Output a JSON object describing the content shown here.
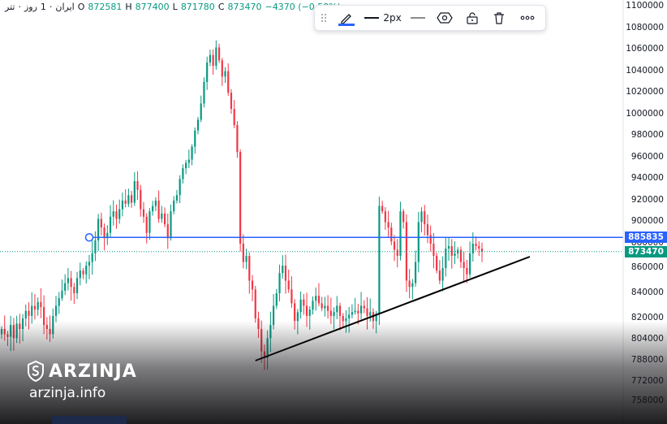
{
  "legend": {
    "symbol": "تتر",
    "separator1": "·",
    "interval": "روز",
    "interval_num": "1",
    "separator2": "·",
    "exchange": "ایران",
    "o_label": "O",
    "o_value": "872581",
    "h_label": "H",
    "h_value": "877400",
    "l_label": "L",
    "l_value": "871780",
    "c_label": "C",
    "c_value": "873470",
    "change": "−4370 (−0.50%)"
  },
  "toolbar": {
    "line_width_label": "2px",
    "icons": [
      "drag-handle-icon",
      "pencil-icon",
      "line-width-icon",
      "line-style-icon",
      "settings-icon",
      "lock-icon",
      "trash-icon",
      "more-icon"
    ]
  },
  "colors": {
    "up": "#089981",
    "down": "#f23645",
    "hline": "#2962ff",
    "trend": "#000000",
    "badge_line": "#2962ff",
    "badge_last": "#089981"
  },
  "chart_data": {
    "type": "candlestick",
    "ylim": [
      750000,
      1100000
    ],
    "yticks": [
      1100000,
      1080000,
      1060000,
      1040000,
      1020000,
      1000000,
      980000,
      960000,
      940000,
      920000,
      900000,
      880000,
      860000,
      840000,
      820000,
      804000,
      788000,
      772000,
      758000
    ],
    "ytick_labels": [
      "1100000",
      "1080000",
      "1060000",
      "1040000",
      "1020000",
      "1000000",
      "980000",
      "960000",
      "940000",
      "920000",
      "900000",
      "880000",
      "860000",
      "840000",
      "820000",
      "804000",
      "788000",
      "772000",
      "758000"
    ],
    "horizontal_line": {
      "value": 885835,
      "label": "885835"
    },
    "last_price": {
      "value": 873470,
      "label": "873470"
    },
    "trendline": {
      "start_index": 84,
      "start_value": 788000,
      "end_index": 162,
      "end_value": 869000
    },
    "closes": [
      812000,
      808000,
      806000,
      815000,
      805000,
      816000,
      812000,
      820000,
      826000,
      822000,
      830000,
      827000,
      833000,
      829000,
      815000,
      812000,
      808000,
      822000,
      830000,
      836000,
      842000,
      848000,
      852000,
      845000,
      840000,
      852000,
      858000,
      855000,
      862000,
      865000,
      872000,
      883000,
      903000,
      895000,
      885000,
      890000,
      905000,
      910000,
      903000,
      912000,
      920000,
      917000,
      925000,
      918000,
      938000,
      930000,
      912000,
      905000,
      890000,
      910000,
      915000,
      920000,
      903000,
      908000,
      898000,
      885000,
      910000,
      920000,
      925000,
      940000,
      950000,
      955000,
      958000,
      970000,
      985000,
      995000,
      1010000,
      1030000,
      1048000,
      1055000,
      1045000,
      1062000,
      1050000,
      1035000,
      1040000,
      1020000,
      1005000,
      990000,
      965000,
      880000,
      865000,
      870000,
      850000,
      843000,
      820000,
      812000,
      795000,
      790000,
      805000,
      815000,
      830000,
      840000,
      856000,
      862000,
      850000,
      843000,
      832000,
      818000,
      825000,
      835000,
      830000,
      822000,
      827000,
      834000,
      838000,
      832000,
      828000,
      830000,
      826000,
      822000,
      825000,
      830000,
      822000,
      818000,
      820000,
      823000,
      825000,
      826000,
      824000,
      830000,
      828000,
      822000,
      825000,
      818000,
      824000,
      915000,
      910000,
      900000,
      895000,
      882000,
      875000,
      870000,
      910000,
      900000,
      850000,
      845000,
      848000,
      865000,
      900000,
      910000,
      898000,
      888000,
      880000,
      870000,
      858000,
      850000,
      860000,
      876000,
      878000,
      870000,
      872000,
      875000,
      865000,
      860000,
      855000,
      872000,
      880000,
      878000,
      876000,
      873470
    ]
  }
}
